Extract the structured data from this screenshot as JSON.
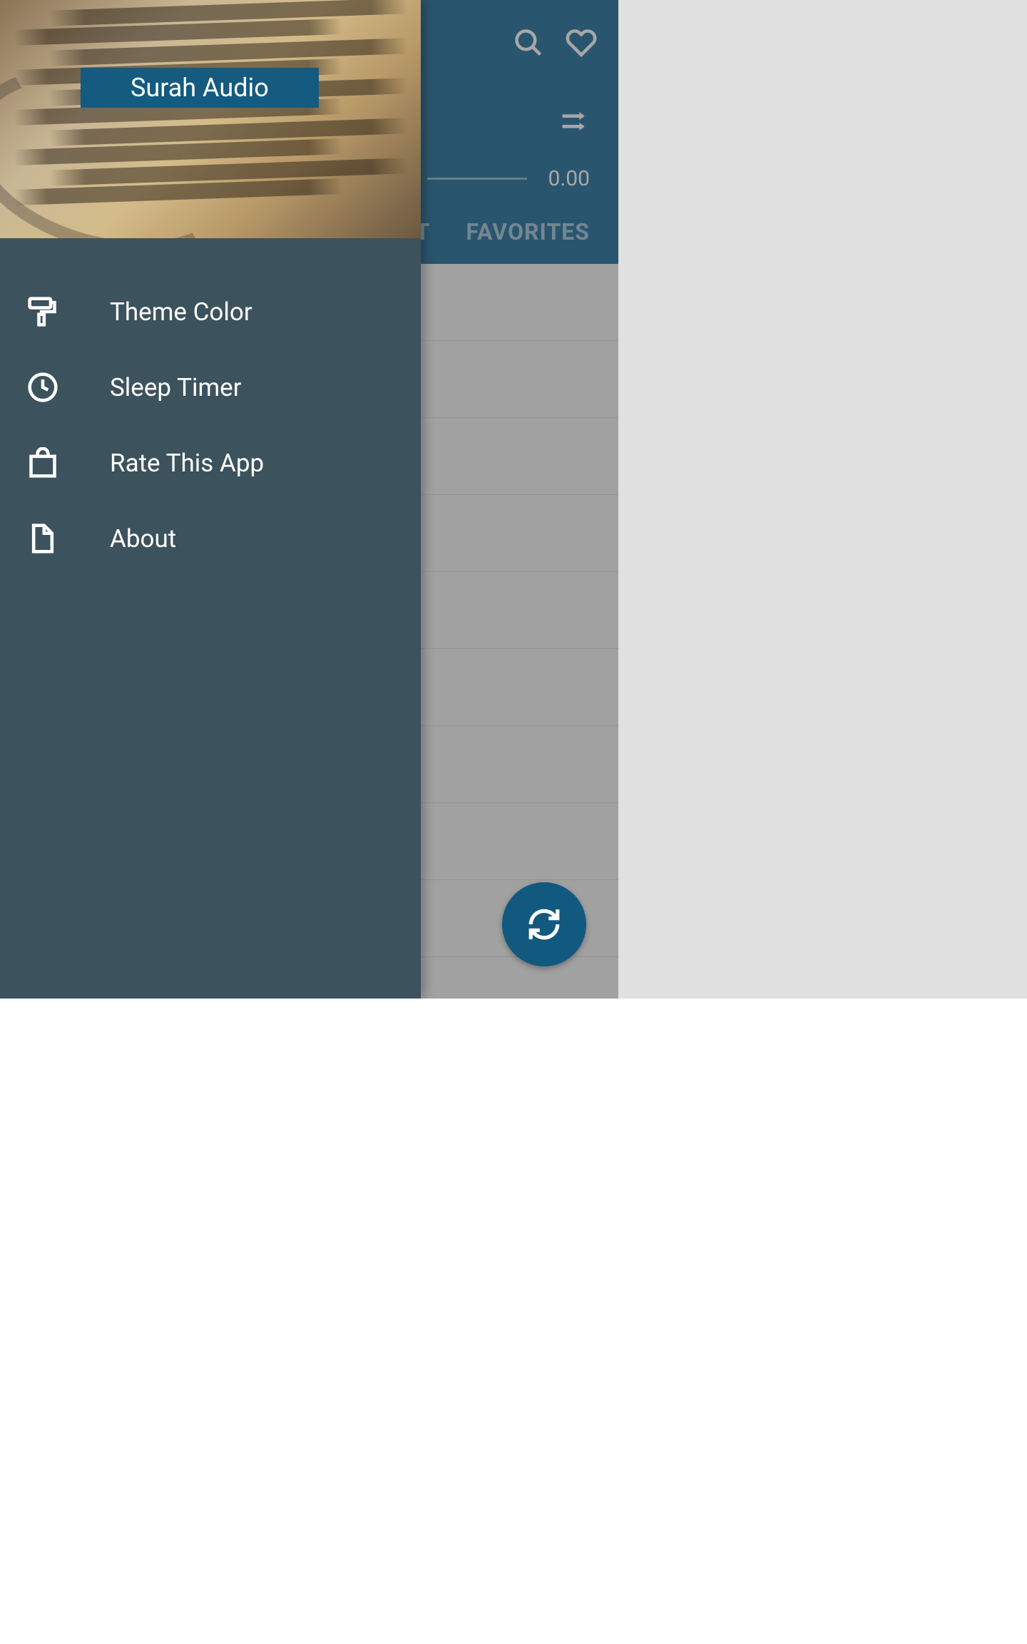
{
  "app": {
    "title": "Surah Audio"
  },
  "header": {
    "search_icon": "search",
    "favorite_icon": "heart"
  },
  "player": {
    "shuffle_icon": "shuffle",
    "time_current": "0.00"
  },
  "tabs": {
    "tracklist_partial": "ST",
    "favorites": "FAVORITES"
  },
  "drawer": {
    "items": [
      {
        "label": "Theme Color",
        "icon": "paint-roller"
      },
      {
        "label": "Sleep Timer",
        "icon": "clock"
      },
      {
        "label": "Rate This App",
        "icon": "shopping-bag"
      },
      {
        "label": "About",
        "icon": "file"
      }
    ]
  },
  "fab": {
    "icon": "refresh"
  }
}
